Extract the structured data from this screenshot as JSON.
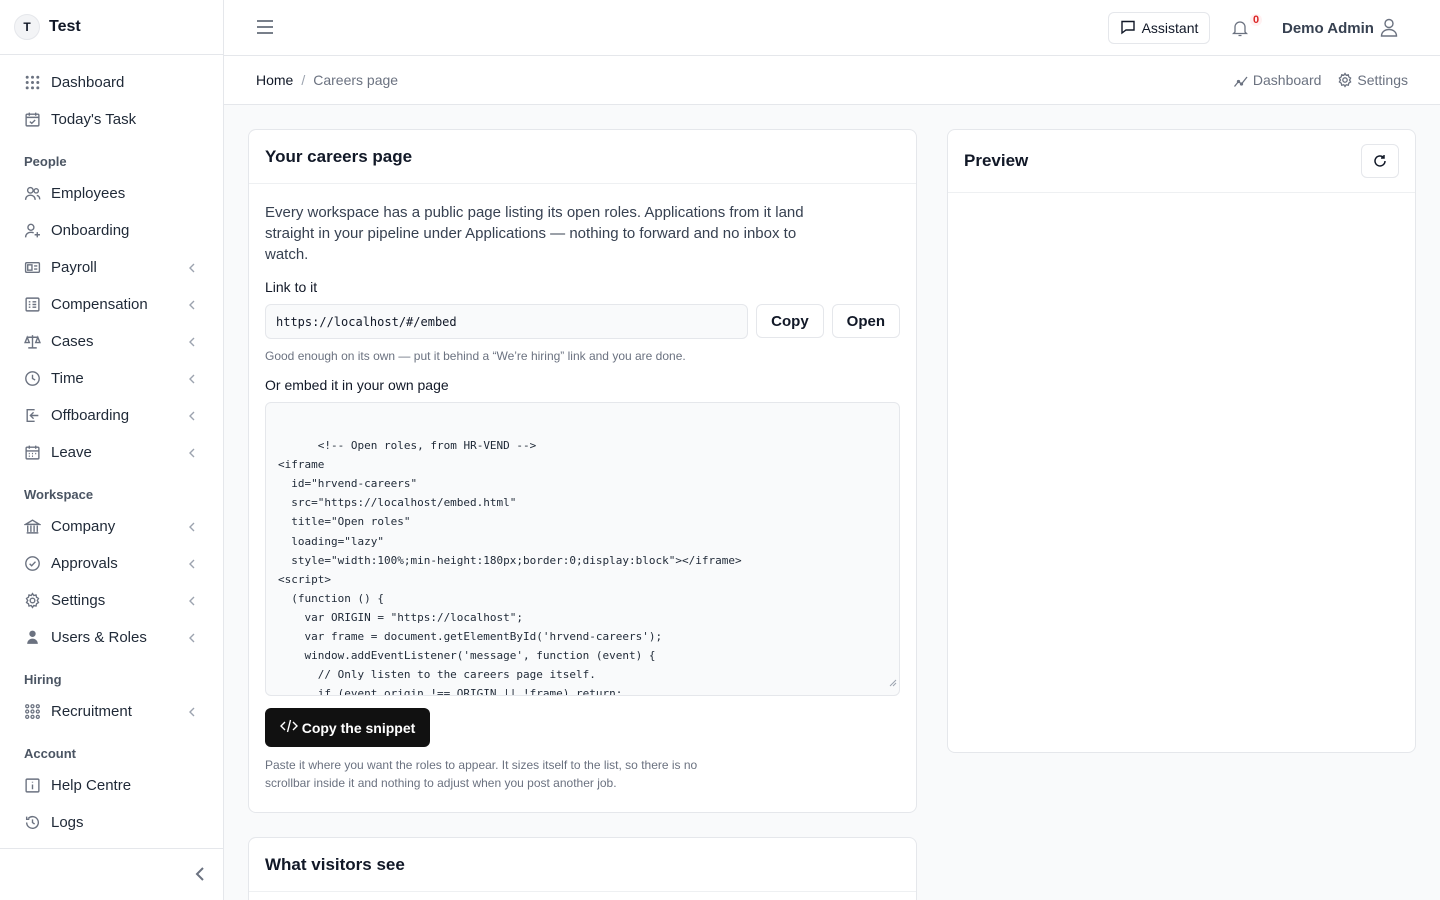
{
  "app": {
    "initial": "T",
    "name": "Test"
  },
  "sidebar": {
    "top_items": [
      {
        "label": "Dashboard",
        "icon": "grid-icon"
      },
      {
        "label": "Today's Task",
        "icon": "calendar-check-icon"
      }
    ],
    "sections": [
      {
        "title": "People"
      },
      {
        "title": "Workspace"
      },
      {
        "title": "Hiring"
      },
      {
        "title": "Account"
      }
    ],
    "people": [
      {
        "label": "Employees"
      },
      {
        "label": "Onboarding"
      },
      {
        "label": "Payroll"
      },
      {
        "label": "Compensation"
      },
      {
        "label": "Cases"
      },
      {
        "label": "Time"
      },
      {
        "label": "Offboarding"
      },
      {
        "label": "Leave"
      }
    ],
    "workspace": [
      {
        "label": "Company"
      },
      {
        "label": "Approvals"
      },
      {
        "label": "Settings"
      },
      {
        "label": "Users & Roles"
      }
    ],
    "hiring": [
      {
        "label": "Recruitment"
      }
    ],
    "account": [
      {
        "label": "Help Centre"
      },
      {
        "label": "Logs"
      }
    ]
  },
  "topbar": {
    "assistant_label": "Assistant",
    "notification_count": "0",
    "user_name": "Demo Admin"
  },
  "breadcrumb": {
    "home": "Home",
    "separator": "/",
    "current": "Careers page",
    "actions": [
      "Dashboard",
      "Settings"
    ]
  },
  "careers_card": {
    "title": "Your careers page",
    "intro": "Every workspace has a public page listing its open roles. Applications from it land straight in your pipeline under Applications — nothing to forward and no inbox to watch.",
    "link_label": "Link to it",
    "link_value": "https://localhost/#/embed",
    "copy_label": "Copy",
    "open_label": "Open",
    "link_hint": "Good enough on its own — put it behind a “We’re hiring” link and you are done.",
    "embed_label": "Or embed it in your own page",
    "snippet": "<!-- Open roles, from HR-VEND -->\n<iframe\n  id=\"hrvend-careers\"\n  src=\"https://localhost/embed.html\"\n  title=\"Open roles\"\n  loading=\"lazy\"\n  style=\"width:100%;min-height:180px;border:0;display:block\"></iframe>\n<script>\n  (function () {\n    var ORIGIN = \"https://localhost\";\n    var frame = document.getElementById('hrvend-careers');\n    window.addEventListener('message', function (event) {\n      // Only listen to the careers page itself.\n      if (event.origin !== ORIGIN || !frame) return;\n      var data = event.data;",
    "copy_snippet_label": "Copy the snippet",
    "snippet_hint": "Paste it where you want the roles to appear. It sizes itself to the list, so there is no scrollbar inside it and nothing to adjust when you post another job."
  },
  "visitors_card": {
    "title": "What visitors see"
  },
  "preview_card": {
    "title": "Preview"
  }
}
